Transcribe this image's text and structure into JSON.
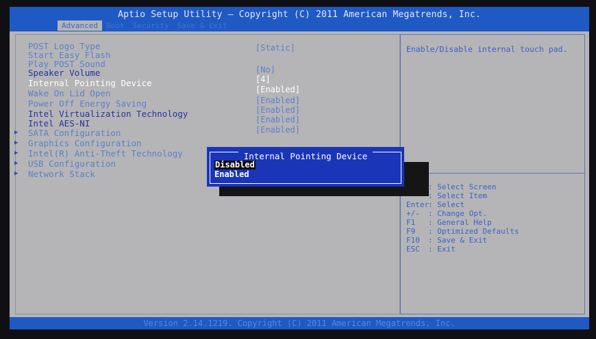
{
  "header": {
    "title": "Aptio Setup Utility – Copyright (C) 2011 American Megatrends, Inc.",
    "tabs": [
      "Advanced",
      "Boot",
      "Security",
      "Save & Exit"
    ]
  },
  "settings": [
    {
      "label": "POST Logo Type",
      "value": "[Static]"
    },
    {
      "label": "Start Easy Flash",
      "value": ""
    },
    {
      "label": "Play POST Sound",
      "value": "[No]"
    },
    {
      "label": "Speaker Volume",
      "value": "[4]"
    },
    {
      "label": "Internal Pointing Device",
      "value": "[Enabled]",
      "selected": true
    },
    {
      "label": "Wake On Lid Open",
      "value": "[Enabled]"
    },
    {
      "label": "Power Off Energy Saving",
      "value": "[Enabled]"
    },
    {
      "label": "Intel Virtualization Technology",
      "value": "[Enabled]"
    },
    {
      "label": "Intel AES-NI",
      "value": "[Enabled]"
    }
  ],
  "submenus": [
    "SATA Configuration",
    "Graphics Configuration",
    "Intel(R) Anti-Theft Technology",
    "USB Configuration",
    "Network Stack"
  ],
  "help": {
    "description": "Enable/Disable internal touch pad.",
    "keys": [
      {
        "key": "",
        "desc": ": Select Screen"
      },
      {
        "key": "",
        "desc": ": Select Item"
      },
      {
        "key": "Enter",
        "desc": ": Select"
      },
      {
        "key": "+/-",
        "desc": ": Change Opt."
      },
      {
        "key": "F1",
        "desc": ": General Help"
      },
      {
        "key": "F9",
        "desc": ": Optimized Defaults"
      },
      {
        "key": "F10",
        "desc": ": Save & Exit"
      },
      {
        "key": "ESC",
        "desc": ": Exit"
      }
    ]
  },
  "popup": {
    "title": "Internal Pointing Device",
    "options": [
      "Disabled",
      "Enabled"
    ],
    "highlighted_option": "Disabled"
  },
  "footer": {
    "text": "Version 2.14.1219. Copyright (C) 2011 American Megatrends, Inc."
  },
  "colors": {
    "header_bg": "#1f59c4",
    "body_bg": "#b5b5b7",
    "popup_bg": "#1a35b8",
    "item_text": "#5d7fc9",
    "selected_text": "#ffffff"
  }
}
